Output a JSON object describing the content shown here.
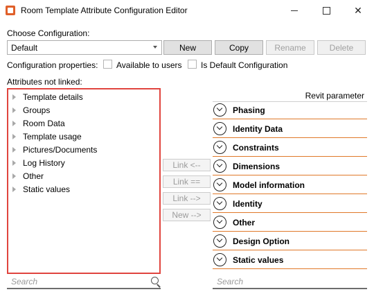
{
  "window": {
    "title": "Room Template Attribute Configuration Editor"
  },
  "configuration": {
    "label": "Choose Configuration:",
    "selected": "Default",
    "buttons": {
      "new": "New",
      "copy": "Copy",
      "rename": "Rename",
      "delete": "Delete"
    },
    "properties_label": "Configuration properties:",
    "available_to_users": {
      "label": "Available to users",
      "checked": false
    },
    "is_default": {
      "label": "Is Default Configuration",
      "checked": false
    }
  },
  "attributes_not_linked": {
    "label": "Attributes not linked:",
    "items": [
      "Template details",
      "Groups",
      "Room Data",
      "Template usage",
      "Pictures/Documents",
      "Log History",
      "Other",
      "Static values"
    ],
    "search_placeholder": "Search"
  },
  "link_buttons": {
    "link_left": "Link <--",
    "link_equal": "Link ==",
    "link_right": "Link -->",
    "new_right": "New -->"
  },
  "revit_parameters": {
    "header": "Revit parameter",
    "groups": [
      "Phasing",
      "Identity Data",
      "Constraints",
      "Dimensions",
      "Model information",
      "Identity",
      "Other",
      "Design Option",
      "Static values"
    ],
    "search_placeholder": "Search"
  },
  "colors": {
    "highlight_border": "#e0443e",
    "group_underline": "#e07828",
    "app_icon": "#e0602a"
  }
}
